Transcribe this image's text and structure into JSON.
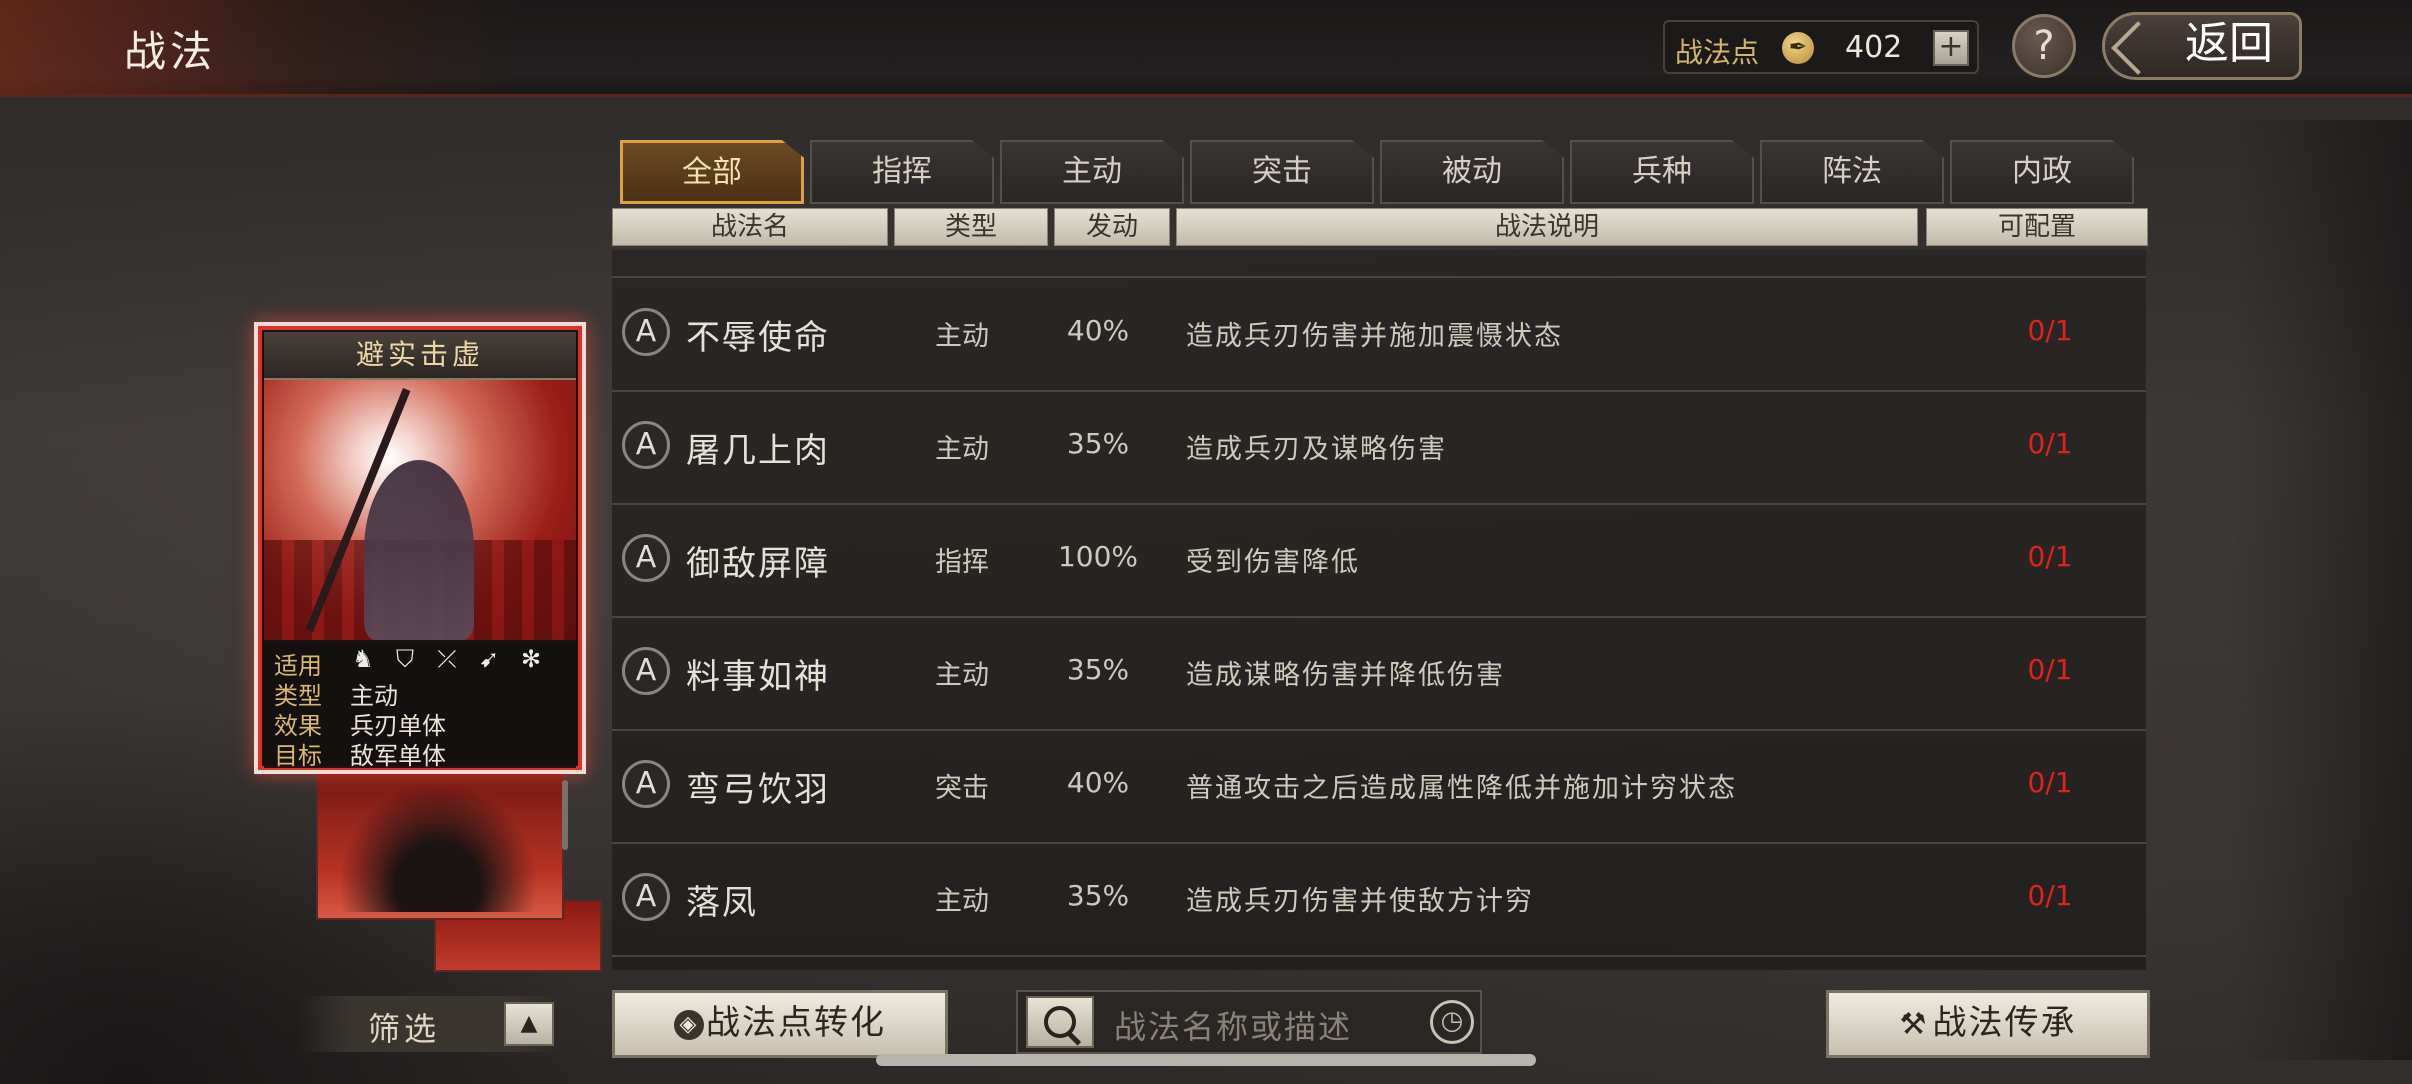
{
  "header": {
    "title": "战法",
    "points_label": "战法点",
    "points_value": "402",
    "add_label": "+",
    "help_label": "?",
    "back_label": "返回"
  },
  "tabs": [
    {
      "label": "全部",
      "active": true
    },
    {
      "label": "指挥",
      "active": false
    },
    {
      "label": "主动",
      "active": false
    },
    {
      "label": "突击",
      "active": false
    },
    {
      "label": "被动",
      "active": false
    },
    {
      "label": "兵种",
      "active": false
    },
    {
      "label": "阵法",
      "active": false
    },
    {
      "label": "内政",
      "active": false
    }
  ],
  "columns": {
    "name": "战法名",
    "type": "类型",
    "rate": "发动",
    "desc": "战法说明",
    "cfg": "可配置"
  },
  "rows": [
    {
      "grade": "A",
      "name": "不辱使命",
      "type": "主动",
      "rate": "40%",
      "desc": "造成兵刃伤害并施加震慑状态",
      "cfg": "0/1"
    },
    {
      "grade": "A",
      "name": "屠几上肉",
      "type": "主动",
      "rate": "35%",
      "desc": "造成兵刃及谋略伤害",
      "cfg": "0/1"
    },
    {
      "grade": "A",
      "name": "御敌屏障",
      "type": "指挥",
      "rate": "100%",
      "desc": "受到伤害降低",
      "cfg": "0/1"
    },
    {
      "grade": "A",
      "name": "料事如神",
      "type": "主动",
      "rate": "35%",
      "desc": "造成谋略伤害并降低伤害",
      "cfg": "0/1"
    },
    {
      "grade": "A",
      "name": "弯弓饮羽",
      "type": "突击",
      "rate": "40%",
      "desc": "普通攻击之后造成属性降低并施加计穷状态",
      "cfg": "0/1"
    },
    {
      "grade": "A",
      "name": "落凤",
      "type": "主动",
      "rate": "35%",
      "desc": "造成兵刃伤害并使敌方计穷",
      "cfg": "0/1"
    }
  ],
  "card": {
    "title": "避实击虚",
    "apply_label": "适用",
    "apply_icons": [
      "cavalry-icon",
      "shield-icon",
      "bow-icon",
      "spear-icon",
      "wheel-icon"
    ],
    "type_label": "类型",
    "type_value": "主动",
    "effect_label": "效果",
    "effect_value": "兵刃单体",
    "target_label": "目标",
    "target_value": "敌军单体"
  },
  "bottom": {
    "filter_label": "筛选",
    "filter_toggle": "▲",
    "convert_label": "战法点转化",
    "search_placeholder": "战法名称或描述",
    "inherit_label": "战法传承"
  },
  "colors": {
    "accent_gold": "#e0a040",
    "config_red": "#e0221c",
    "card_border": "#d8342a"
  }
}
